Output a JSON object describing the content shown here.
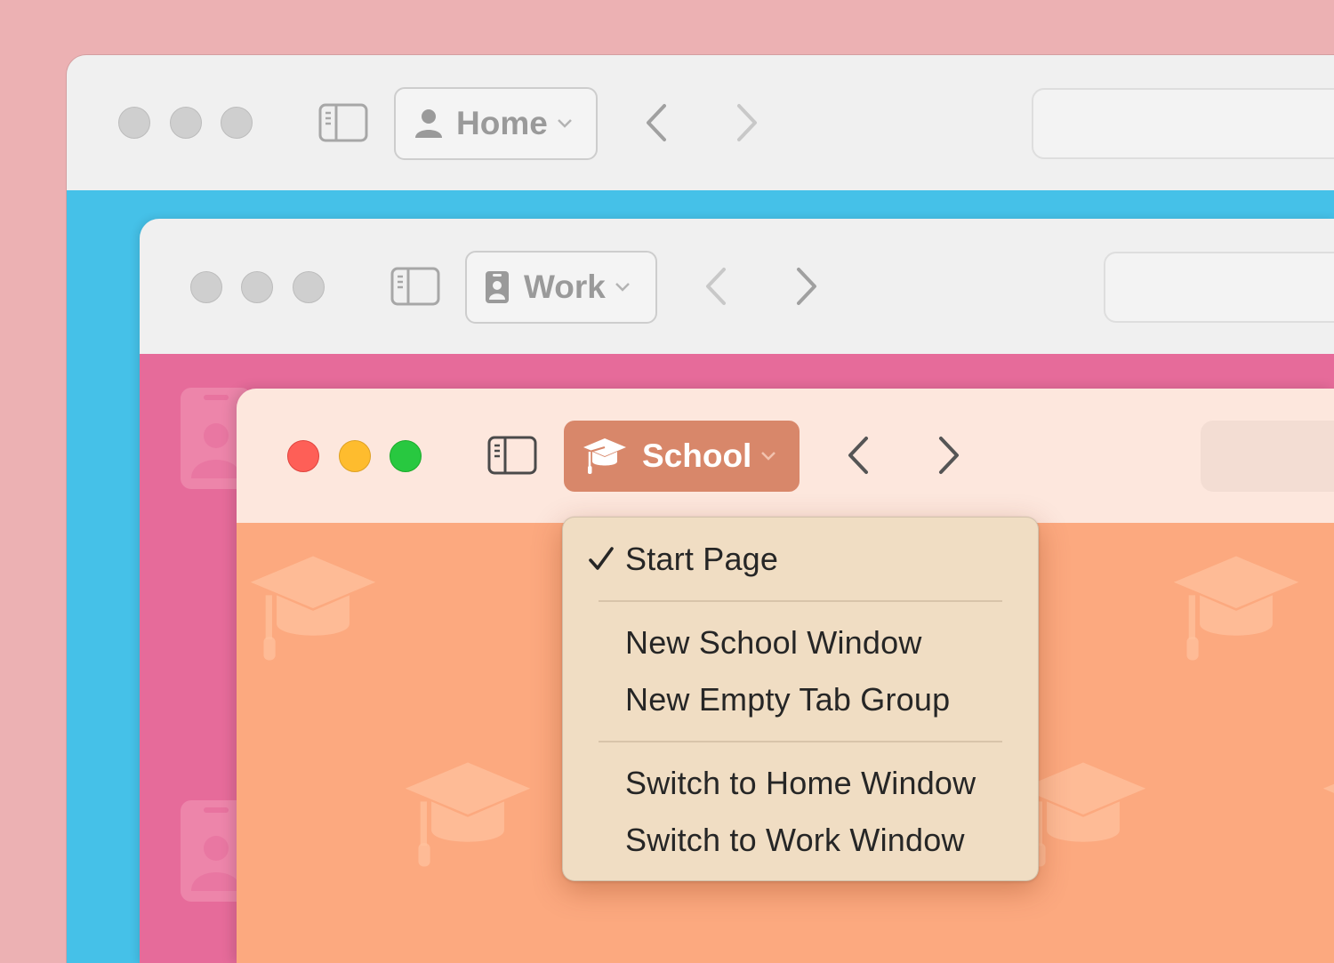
{
  "windows": {
    "home": {
      "profile_label": "Home",
      "profile_icon": "person-icon"
    },
    "work": {
      "profile_label": "Work",
      "profile_icon": "id-badge-icon"
    },
    "school": {
      "profile_label": "School",
      "profile_icon": "graduation-cap-icon"
    }
  },
  "menu": {
    "items": [
      {
        "label": "Start Page",
        "checked": true
      },
      {
        "label": "New School Window"
      },
      {
        "label": "New Empty Tab Group"
      },
      {
        "label": "Switch to Home Window"
      },
      {
        "label": "Switch to Work Window"
      }
    ]
  },
  "colors": {
    "desktop": "#ecb1b3",
    "home_bg": "#45c1e8",
    "work_bg": "#e66b9a",
    "school_bg": "#fca97f",
    "school_button": "#d8876a",
    "menu_bg": "#f0ddc3",
    "traffic_red": "#fe5f57",
    "traffic_yellow": "#febc2e",
    "traffic_green": "#28c840"
  }
}
